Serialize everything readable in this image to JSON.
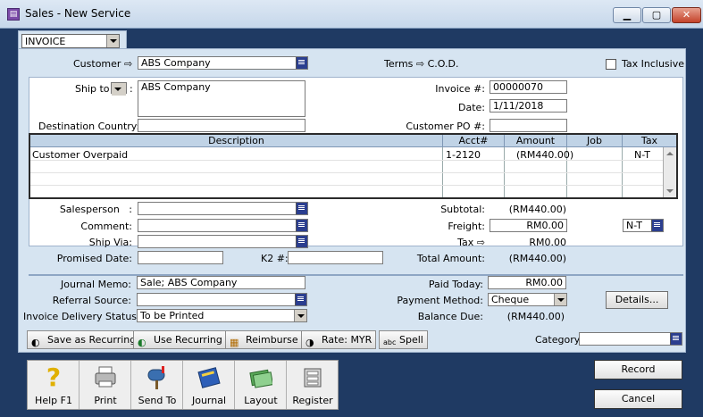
{
  "window": {
    "title": "Sales - New Service"
  },
  "form_type": {
    "value": "INVOICE"
  },
  "header": {
    "customer_label": "Customer",
    "customer_value": "ABS Company",
    "terms_label": "Terms",
    "terms_value": "C.O.D.",
    "tax_inclusive_label": "Tax Inclusive"
  },
  "shipping": {
    "ship_to_label": "Ship to",
    "ship_to_value": "ABS Company",
    "destination_country_label": "Destination Country:"
  },
  "invoice": {
    "invoice_no_label": "Invoice #:",
    "invoice_no_value": "00000070",
    "date_label": "Date:",
    "date_value": "1/11/2018",
    "customer_po_label": "Customer PO #:"
  },
  "grid": {
    "headers": [
      "Description",
      "Acct#",
      "Amount",
      "Job",
      "Tax"
    ],
    "rows": [
      {
        "description": "Customer Overpaid",
        "acct": "1-2120",
        "amount": "(RM440.00)",
        "job": "",
        "tax": "N-T"
      }
    ]
  },
  "details": {
    "salesperson_label": "Salesperson",
    "comment_label": "Comment:",
    "ship_via_label": "Ship Via:",
    "promised_date_label": "Promised Date:",
    "k2_label": "K2 #:"
  },
  "totals": {
    "subtotal_label": "Subtotal:",
    "subtotal_value": "(RM440.00)",
    "freight_label": "Freight:",
    "freight_value": "RM0.00",
    "freight_tax": "N-T",
    "tax_label": "Tax",
    "tax_value": "RM0.00",
    "total_amount_label": "Total Amount:",
    "total_amount_value": "(RM440.00)"
  },
  "footer": {
    "journal_memo_label": "Journal Memo:",
    "journal_memo_value": "Sale; ABS Company",
    "referral_source_label": "Referral Source:",
    "delivery_status_label": "Invoice Delivery Status:",
    "delivery_status_value": "To be Printed",
    "paid_today_label": "Paid Today:",
    "paid_today_value": "RM0.00",
    "payment_method_label": "Payment Method:",
    "payment_method_value": "Cheque",
    "details_button": "Details...",
    "balance_due_label": "Balance Due:",
    "balance_due_value": "(RM440.00)"
  },
  "toolbar": {
    "save_recurring": "Save as Recurring",
    "use_recurring": "Use Recurring",
    "reimburse": "Reimburse",
    "rate": "Rate:",
    "rate_currency": "MYR",
    "spell": "Spell",
    "category_label": "Category:"
  },
  "bottom_bar": {
    "help": "Help F1",
    "print": "Print",
    "send_to": "Send To",
    "journal": "Journal",
    "layout": "Layout",
    "register": "Register"
  },
  "actions": {
    "record": "Record",
    "cancel": "Cancel"
  },
  "colors": {
    "panel": "#d6e4f1",
    "background": "#1f3a63",
    "lookup": "#2b3e8f"
  }
}
